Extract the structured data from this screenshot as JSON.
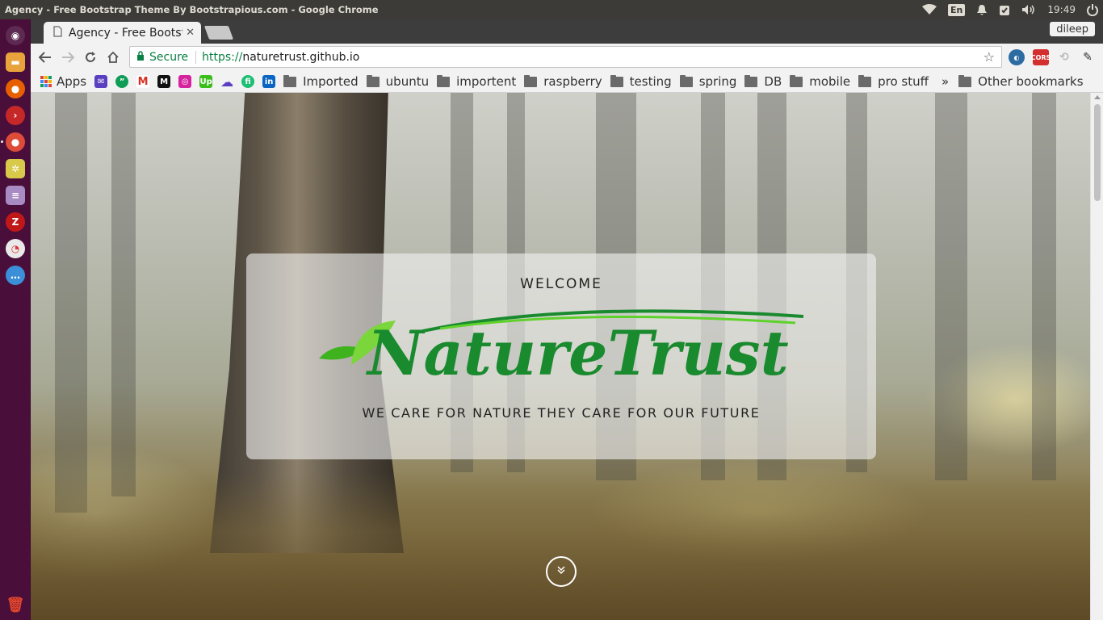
{
  "window": {
    "title": "Agency - Free Bootstrap Theme By Bootstrapious.com - Google Chrome"
  },
  "system": {
    "lang": "En",
    "clock": "19:49"
  },
  "browser": {
    "tab_title": "Agency - Free Bootstrap Theme",
    "profile": "dileep",
    "secure_label": "Secure",
    "url_scheme": "https://",
    "url_host": "naturetrust.github.io"
  },
  "bookmarks": {
    "apps_label": "Apps",
    "folders": [
      "Imported",
      "ubuntu",
      "importent",
      "raspberry",
      "testing",
      "spring",
      "DB",
      "mobile",
      "pro stuff"
    ],
    "more": "»",
    "other": "Other bookmarks"
  },
  "extensions": {
    "cors_label": "CORS"
  },
  "hero": {
    "welcome": "WELCOME",
    "logo_text": "NatureTrust",
    "tagline": "WE CARE FOR NATURE THEY CARE FOR OUR FUTURE"
  },
  "colors": {
    "logo_dark_green": "#1a8a2e",
    "logo_light_green": "#5ed12b",
    "secure_green": "#0b8043",
    "launcher_bg": "#4a0e3b"
  }
}
